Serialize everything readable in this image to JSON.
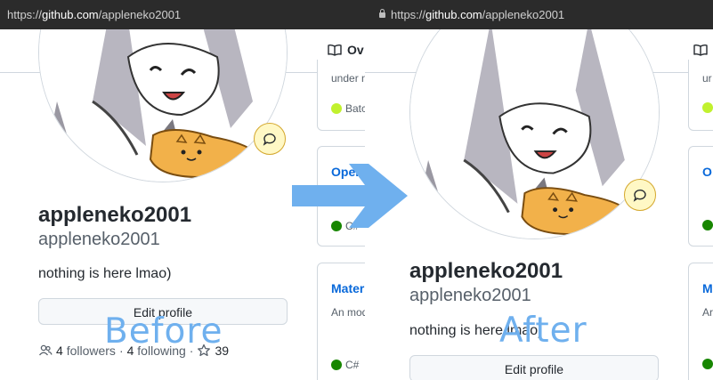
{
  "url": {
    "before_prefix": "https://",
    "before_host": "github.com",
    "before_path": "/appleneko2001",
    "after_prefix": "https://",
    "after_host": "github.com",
    "after_path": "/appleneko2001"
  },
  "profile": {
    "name": "appleneko2001",
    "login": "appleneko2001",
    "bio": "nothing is here lmao)",
    "edit_label": "Edit profile",
    "followers_count": "4",
    "followers_label": "followers",
    "separator": "·",
    "following_count": "4",
    "following_label": "following",
    "stars_count": "39"
  },
  "tabs": {
    "overview_clipped": "Ov"
  },
  "repos": {
    "before": {
      "card0_desc": "under n",
      "card0_lang": "Batc",
      "card1_name": "Open(",
      "card1_lang": "C#",
      "card2_name": "Mater",
      "card2_desc": "An mod",
      "card2_lang": "C#"
    },
    "after": {
      "card0_desc": "ur",
      "card1_name": "O",
      "card2_name": "M",
      "card2_desc": "Ar"
    }
  },
  "colors": {
    "batch": "#c1f12e",
    "csharp": "#178600",
    "accent_tab": "#fd8c73",
    "link": "#0969da",
    "overlay_text": "#6fb0ee"
  },
  "labels": {
    "before": "Before",
    "after": "After"
  },
  "icons": [
    "lock-icon",
    "book-icon",
    "comment-icon",
    "people-icon",
    "star-icon",
    "arrow-right-icon"
  ]
}
